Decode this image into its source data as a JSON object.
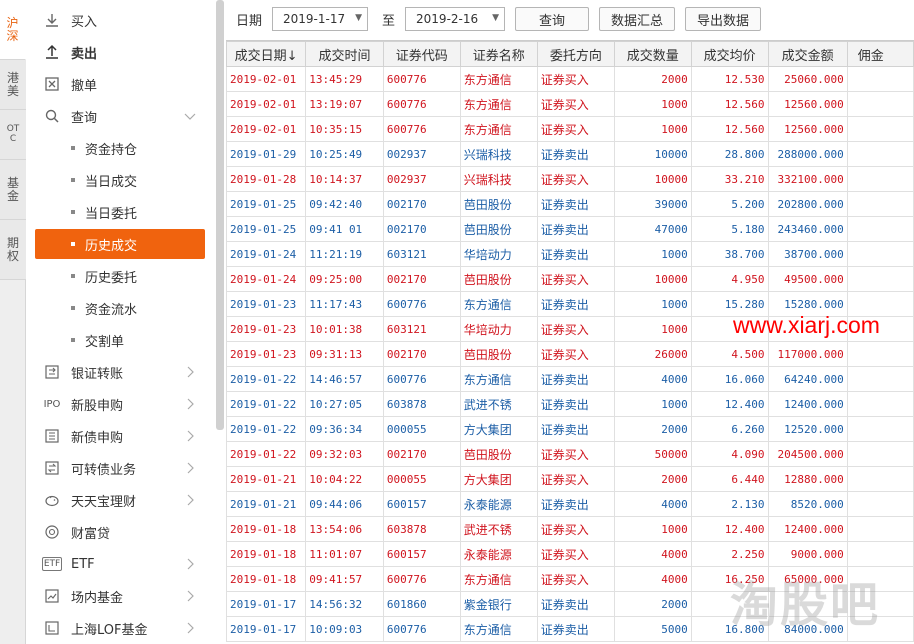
{
  "vtabs": [
    {
      "label": "沪深",
      "active": true
    },
    {
      "label": "港美",
      "active": false
    },
    {
      "label": "OTC",
      "active": false
    },
    {
      "label": "基金",
      "active": false
    },
    {
      "label": "期权",
      "active": false
    }
  ],
  "sidebar": {
    "items": [
      {
        "label": "买入",
        "icon": "download-icon"
      },
      {
        "label": "卖出",
        "icon": "upload-icon"
      },
      {
        "label": "撤单",
        "icon": "cancel-box-icon"
      },
      {
        "label": "查询",
        "icon": "search-icon"
      }
    ],
    "sub_items": [
      {
        "label": "资金持仓"
      },
      {
        "label": "当日成交"
      },
      {
        "label": "当日委托"
      },
      {
        "label": "历史成交"
      },
      {
        "label": "历史委托"
      },
      {
        "label": "资金流水"
      },
      {
        "label": "交割单"
      }
    ],
    "more_items": [
      {
        "label": "银证转账",
        "icon": "bank-transfer-icon"
      },
      {
        "label": "新股申购",
        "icon": "ipo-icon",
        "icon_text": "IPO"
      },
      {
        "label": "新债申购",
        "icon": "bond-icon"
      },
      {
        "label": "可转债业务",
        "icon": "convertible-bond-icon"
      },
      {
        "label": "天天宝理财",
        "icon": "piggy-bank-icon"
      },
      {
        "label": "财富贷",
        "icon": "loan-icon"
      },
      {
        "label": "ETF",
        "icon": "etf-icon",
        "icon_text": "ETF"
      },
      {
        "label": "场内基金",
        "icon": "fund-chart-icon"
      },
      {
        "label": "上海LOF基金",
        "icon": "lof-fund-icon",
        "icon_text": "LOF"
      }
    ]
  },
  "toolbar": {
    "date_label": "日期",
    "start_date": "2019-1-17",
    "to_label": "至",
    "end_date": "2019-2-16",
    "query_button": "查询",
    "summary_button": "数据汇总",
    "export_button": "导出数据"
  },
  "table": {
    "headers": [
      "成交日期↓",
      "成交时间",
      "证券代码",
      "证券名称",
      "委托方向",
      "成交数量",
      "成交均价",
      "成交金额",
      "佣金"
    ],
    "rows": [
      {
        "date": "2019-02-01",
        "time": "13:45:29",
        "code": "600776",
        "name": "东方通信",
        "dir": "证券买入",
        "qty": "2000",
        "price": "12.530",
        "amount": "25060.000",
        "side": "buy"
      },
      {
        "date": "2019-02-01",
        "time": "13:19:07",
        "code": "600776",
        "name": "东方通信",
        "dir": "证券买入",
        "qty": "1000",
        "price": "12.560",
        "amount": "12560.000",
        "side": "buy"
      },
      {
        "date": "2019-02-01",
        "time": "10:35:15",
        "code": "600776",
        "name": "东方通信",
        "dir": "证券买入",
        "qty": "1000",
        "price": "12.560",
        "amount": "12560.000",
        "side": "buy"
      },
      {
        "date": "2019-01-29",
        "time": "10:25:49",
        "code": "002937",
        "name": "兴瑞科技",
        "dir": "证券卖出",
        "qty": "10000",
        "price": "28.800",
        "amount": "288000.000",
        "side": "sell"
      },
      {
        "date": "2019-01-28",
        "time": "10:14:37",
        "code": "002937",
        "name": "兴瑞科技",
        "dir": "证券买入",
        "qty": "10000",
        "price": "33.210",
        "amount": "332100.000",
        "side": "buy"
      },
      {
        "date": "2019-01-25",
        "time": "09:42:40",
        "code": "002170",
        "name": "芭田股份",
        "dir": "证券卖出",
        "qty": "39000",
        "price": "5.200",
        "amount": "202800.000",
        "side": "sell"
      },
      {
        "date": "2019-01-25",
        "time": "09:41 01",
        "code": "002170",
        "name": "芭田股份",
        "dir": "证券卖出",
        "qty": "47000",
        "price": "5.180",
        "amount": "243460.000",
        "side": "sell"
      },
      {
        "date": "2019-01-24",
        "time": "11:21:19",
        "code": "603121",
        "name": "华培动力",
        "dir": "证券卖出",
        "qty": "1000",
        "price": "38.700",
        "amount": "38700.000",
        "side": "sell"
      },
      {
        "date": "2019-01-24",
        "time": "09:25:00",
        "code": "002170",
        "name": "芭田股份",
        "dir": "证券买入",
        "qty": "10000",
        "price": "4.950",
        "amount": "49500.000",
        "side": "buy"
      },
      {
        "date": "2019-01-23",
        "time": "11:17:43",
        "code": "600776",
        "name": "东方通信",
        "dir": "证券卖出",
        "qty": "1000",
        "price": "15.280",
        "amount": "15280.000",
        "side": "sell"
      },
      {
        "date": "2019-01-23",
        "time": "10:01:38",
        "code": "603121",
        "name": "华培动力",
        "dir": "证券买入",
        "qty": "1000",
        "price": "",
        "amount": "",
        "side": "buy"
      },
      {
        "date": "2019-01-23",
        "time": "09:31:13",
        "code": "002170",
        "name": "芭田股份",
        "dir": "证券买入",
        "qty": "26000",
        "price": "4.500",
        "amount": "117000.000",
        "side": "buy"
      },
      {
        "date": "2019-01-22",
        "time": "14:46:57",
        "code": "600776",
        "name": "东方通信",
        "dir": "证券卖出",
        "qty": "4000",
        "price": "16.060",
        "amount": "64240.000",
        "side": "sell"
      },
      {
        "date": "2019-01-22",
        "time": "10:27:05",
        "code": "603878",
        "name": "武进不锈",
        "dir": "证券卖出",
        "qty": "1000",
        "price": "12.400",
        "amount": "12400.000",
        "side": "sell"
      },
      {
        "date": "2019-01-22",
        "time": "09:36:34",
        "code": "000055",
        "name": "方大集团",
        "dir": "证券卖出",
        "qty": "2000",
        "price": "6.260",
        "amount": "12520.000",
        "side": "sell"
      },
      {
        "date": "2019-01-22",
        "time": "09:32:03",
        "code": "002170",
        "name": "芭田股份",
        "dir": "证券买入",
        "qty": "50000",
        "price": "4.090",
        "amount": "204500.000",
        "side": "buy"
      },
      {
        "date": "2019-01-21",
        "time": "10:04:22",
        "code": "000055",
        "name": "方大集团",
        "dir": "证券买入",
        "qty": "2000",
        "price": "6.440",
        "amount": "12880.000",
        "side": "buy"
      },
      {
        "date": "2019-01-21",
        "time": "09:44:06",
        "code": "600157",
        "name": "永泰能源",
        "dir": "证券卖出",
        "qty": "4000",
        "price": "2.130",
        "amount": "8520.000",
        "side": "sell"
      },
      {
        "date": "2019-01-18",
        "time": "13:54:06",
        "code": "603878",
        "name": "武进不锈",
        "dir": "证券买入",
        "qty": "1000",
        "price": "12.400",
        "amount": "12400.000",
        "side": "buy"
      },
      {
        "date": "2019-01-18",
        "time": "11:01:07",
        "code": "600157",
        "name": "永泰能源",
        "dir": "证券买入",
        "qty": "4000",
        "price": "2.250",
        "amount": "9000.000",
        "side": "buy"
      },
      {
        "date": "2019-01-18",
        "time": "09:41:57",
        "code": "600776",
        "name": "东方通信",
        "dir": "证券买入",
        "qty": "4000",
        "price": "16.250",
        "amount": "65000.000",
        "side": "buy"
      },
      {
        "date": "2019-01-17",
        "time": "14:56:32",
        "code": "601860",
        "name": "紫金银行",
        "dir": "证券卖出",
        "qty": "2000",
        "price": "",
        "amount": "",
        "side": "sell"
      },
      {
        "date": "2019-01-17",
        "time": "10:09:03",
        "code": "600776",
        "name": "东方通信",
        "dir": "证券卖出",
        "qty": "5000",
        "price": "16.800",
        "amount": "84000.000",
        "side": "sell"
      }
    ]
  },
  "watermark": {
    "site": "www.xiarj.com",
    "brand": "淘股吧"
  },
  "colors": {
    "accent": "#f0630e",
    "buy": "#d0141e",
    "sell": "#1c5ea6"
  }
}
